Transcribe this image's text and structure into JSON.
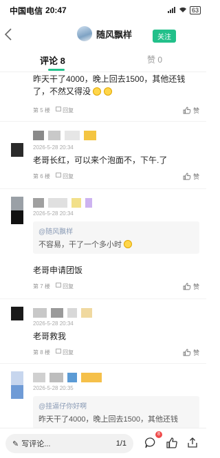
{
  "status_bar": {
    "carrier": "中国电信",
    "time": "20:47",
    "battery": "63"
  },
  "nav": {
    "author_name": "随风飘样",
    "follow_label": "关注"
  },
  "tabs": {
    "comments": "评论 8",
    "likes": "赞 0"
  },
  "comments": [
    {
      "content": "昨天干了4000，晚上回去1500，其他还钱了，不然又得没",
      "floor": "第 5 楼",
      "reply": "回复",
      "like": "赞"
    },
    {
      "meta": "2026-5-28 20:34",
      "content": "老哥长红，可以来个泡面不，下午.了",
      "floor": "第 6 楼",
      "reply": "回复",
      "like": "赞"
    },
    {
      "meta": "2026-5-28 20:34",
      "quote_name": "@随风飘样",
      "quote_text": "不容易，干了一个多小时",
      "content": "老哥申请团饭",
      "floor": "第 7 楼",
      "reply": "回复",
      "like": "赞"
    },
    {
      "meta": "2026-5-28 20:34",
      "content": "老哥救我",
      "floor": "第 8 楼",
      "reply": "回复",
      "like": "赞"
    },
    {
      "meta": "2026-5-28 20:35",
      "quote_name": "@挂逼仔你好啊",
      "quote_text": "昨天干了4000，晚上回去1500，其他还钱"
    }
  ],
  "bottom_bar": {
    "write_placeholder": "写评论...",
    "page_indicator": "1/1",
    "comment_badge": "8"
  },
  "colors": {
    "accent": "#22c08a",
    "badge": "#f04b4b"
  }
}
